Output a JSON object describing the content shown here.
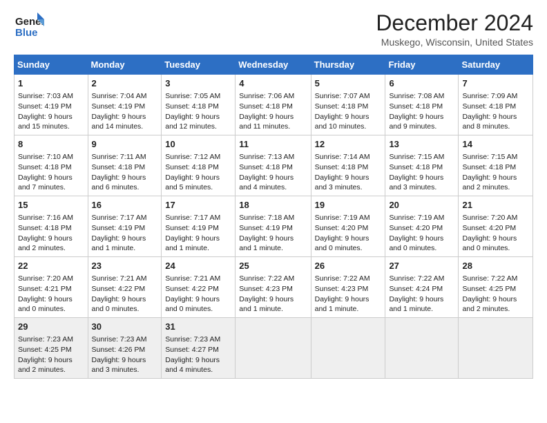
{
  "logo": {
    "line1": "General",
    "line2": "Blue",
    "icon_color": "#2d6fc4"
  },
  "title": "December 2024",
  "location": "Muskego, Wisconsin, United States",
  "days_of_week": [
    "Sunday",
    "Monday",
    "Tuesday",
    "Wednesday",
    "Thursday",
    "Friday",
    "Saturday"
  ],
  "weeks": [
    [
      {
        "day": "1",
        "sunrise": "Sunrise: 7:03 AM",
        "sunset": "Sunset: 4:19 PM",
        "daylight": "Daylight: 9 hours and 15 minutes."
      },
      {
        "day": "2",
        "sunrise": "Sunrise: 7:04 AM",
        "sunset": "Sunset: 4:19 PM",
        "daylight": "Daylight: 9 hours and 14 minutes."
      },
      {
        "day": "3",
        "sunrise": "Sunrise: 7:05 AM",
        "sunset": "Sunset: 4:18 PM",
        "daylight": "Daylight: 9 hours and 12 minutes."
      },
      {
        "day": "4",
        "sunrise": "Sunrise: 7:06 AM",
        "sunset": "Sunset: 4:18 PM",
        "daylight": "Daylight: 9 hours and 11 minutes."
      },
      {
        "day": "5",
        "sunrise": "Sunrise: 7:07 AM",
        "sunset": "Sunset: 4:18 PM",
        "daylight": "Daylight: 9 hours and 10 minutes."
      },
      {
        "day": "6",
        "sunrise": "Sunrise: 7:08 AM",
        "sunset": "Sunset: 4:18 PM",
        "daylight": "Daylight: 9 hours and 9 minutes."
      },
      {
        "day": "7",
        "sunrise": "Sunrise: 7:09 AM",
        "sunset": "Sunset: 4:18 PM",
        "daylight": "Daylight: 9 hours and 8 minutes."
      }
    ],
    [
      {
        "day": "8",
        "sunrise": "Sunrise: 7:10 AM",
        "sunset": "Sunset: 4:18 PM",
        "daylight": "Daylight: 9 hours and 7 minutes."
      },
      {
        "day": "9",
        "sunrise": "Sunrise: 7:11 AM",
        "sunset": "Sunset: 4:18 PM",
        "daylight": "Daylight: 9 hours and 6 minutes."
      },
      {
        "day": "10",
        "sunrise": "Sunrise: 7:12 AM",
        "sunset": "Sunset: 4:18 PM",
        "daylight": "Daylight: 9 hours and 5 minutes."
      },
      {
        "day": "11",
        "sunrise": "Sunrise: 7:13 AM",
        "sunset": "Sunset: 4:18 PM",
        "daylight": "Daylight: 9 hours and 4 minutes."
      },
      {
        "day": "12",
        "sunrise": "Sunrise: 7:14 AM",
        "sunset": "Sunset: 4:18 PM",
        "daylight": "Daylight: 9 hours and 3 minutes."
      },
      {
        "day": "13",
        "sunrise": "Sunrise: 7:15 AM",
        "sunset": "Sunset: 4:18 PM",
        "daylight": "Daylight: 9 hours and 3 minutes."
      },
      {
        "day": "14",
        "sunrise": "Sunrise: 7:15 AM",
        "sunset": "Sunset: 4:18 PM",
        "daylight": "Daylight: 9 hours and 2 minutes."
      }
    ],
    [
      {
        "day": "15",
        "sunrise": "Sunrise: 7:16 AM",
        "sunset": "Sunset: 4:18 PM",
        "daylight": "Daylight: 9 hours and 2 minutes."
      },
      {
        "day": "16",
        "sunrise": "Sunrise: 7:17 AM",
        "sunset": "Sunset: 4:19 PM",
        "daylight": "Daylight: 9 hours and 1 minute."
      },
      {
        "day": "17",
        "sunrise": "Sunrise: 7:17 AM",
        "sunset": "Sunset: 4:19 PM",
        "daylight": "Daylight: 9 hours and 1 minute."
      },
      {
        "day": "18",
        "sunrise": "Sunrise: 7:18 AM",
        "sunset": "Sunset: 4:19 PM",
        "daylight": "Daylight: 9 hours and 1 minute."
      },
      {
        "day": "19",
        "sunrise": "Sunrise: 7:19 AM",
        "sunset": "Sunset: 4:20 PM",
        "daylight": "Daylight: 9 hours and 0 minutes."
      },
      {
        "day": "20",
        "sunrise": "Sunrise: 7:19 AM",
        "sunset": "Sunset: 4:20 PM",
        "daylight": "Daylight: 9 hours and 0 minutes."
      },
      {
        "day": "21",
        "sunrise": "Sunrise: 7:20 AM",
        "sunset": "Sunset: 4:20 PM",
        "daylight": "Daylight: 9 hours and 0 minutes."
      }
    ],
    [
      {
        "day": "22",
        "sunrise": "Sunrise: 7:20 AM",
        "sunset": "Sunset: 4:21 PM",
        "daylight": "Daylight: 9 hours and 0 minutes."
      },
      {
        "day": "23",
        "sunrise": "Sunrise: 7:21 AM",
        "sunset": "Sunset: 4:22 PM",
        "daylight": "Daylight: 9 hours and 0 minutes."
      },
      {
        "day": "24",
        "sunrise": "Sunrise: 7:21 AM",
        "sunset": "Sunset: 4:22 PM",
        "daylight": "Daylight: 9 hours and 0 minutes."
      },
      {
        "day": "25",
        "sunrise": "Sunrise: 7:22 AM",
        "sunset": "Sunset: 4:23 PM",
        "daylight": "Daylight: 9 hours and 1 minute."
      },
      {
        "day": "26",
        "sunrise": "Sunrise: 7:22 AM",
        "sunset": "Sunset: 4:23 PM",
        "daylight": "Daylight: 9 hours and 1 minute."
      },
      {
        "day": "27",
        "sunrise": "Sunrise: 7:22 AM",
        "sunset": "Sunset: 4:24 PM",
        "daylight": "Daylight: 9 hours and 1 minute."
      },
      {
        "day": "28",
        "sunrise": "Sunrise: 7:22 AM",
        "sunset": "Sunset: 4:25 PM",
        "daylight": "Daylight: 9 hours and 2 minutes."
      }
    ],
    [
      {
        "day": "29",
        "sunrise": "Sunrise: 7:23 AM",
        "sunset": "Sunset: 4:25 PM",
        "daylight": "Daylight: 9 hours and 2 minutes."
      },
      {
        "day": "30",
        "sunrise": "Sunrise: 7:23 AM",
        "sunset": "Sunset: 4:26 PM",
        "daylight": "Daylight: 9 hours and 3 minutes."
      },
      {
        "day": "31",
        "sunrise": "Sunrise: 7:23 AM",
        "sunset": "Sunset: 4:27 PM",
        "daylight": "Daylight: 9 hours and 4 minutes."
      },
      null,
      null,
      null,
      null
    ]
  ]
}
